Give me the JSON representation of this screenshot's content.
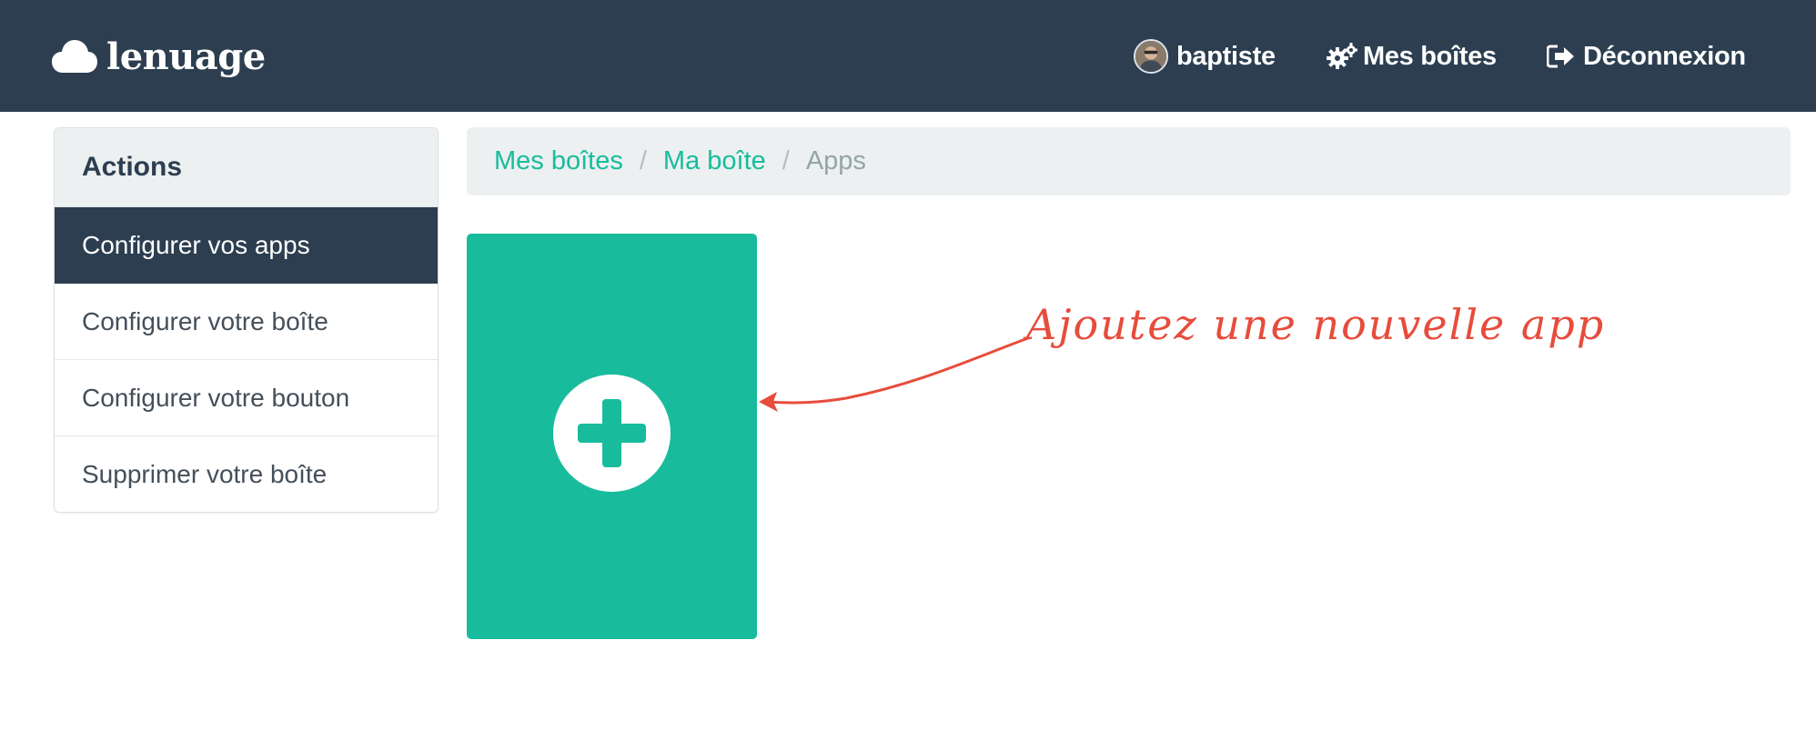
{
  "brand": {
    "name": "lenuage",
    "icon": "cloud-icon"
  },
  "nav": {
    "user": {
      "label": "baptiste",
      "icon": "avatar"
    },
    "boxes": {
      "label": "Mes boîtes",
      "icon": "gears-icon"
    },
    "logout": {
      "label": "Déconnexion",
      "icon": "sign-out-icon"
    }
  },
  "sidebar": {
    "heading": "Actions",
    "items": [
      {
        "label": "Configurer vos apps",
        "active": true
      },
      {
        "label": "Configurer votre boîte"
      },
      {
        "label": "Configurer votre bouton"
      },
      {
        "label": "Supprimer votre boîte"
      }
    ]
  },
  "breadcrumb": {
    "items": [
      {
        "label": "Mes boîtes"
      },
      {
        "label": "Ma boîte"
      },
      {
        "label": "Apps"
      }
    ],
    "separator": "/"
  },
  "add_tile": {
    "icon": "plus-icon"
  },
  "annotation": {
    "text": "Ajoutez une nouvelle app"
  },
  "colors": {
    "navbar": "#2c3e50",
    "accent": "#18bc9c",
    "annotation": "#e74c3c",
    "panel": "#ecf0f1"
  }
}
